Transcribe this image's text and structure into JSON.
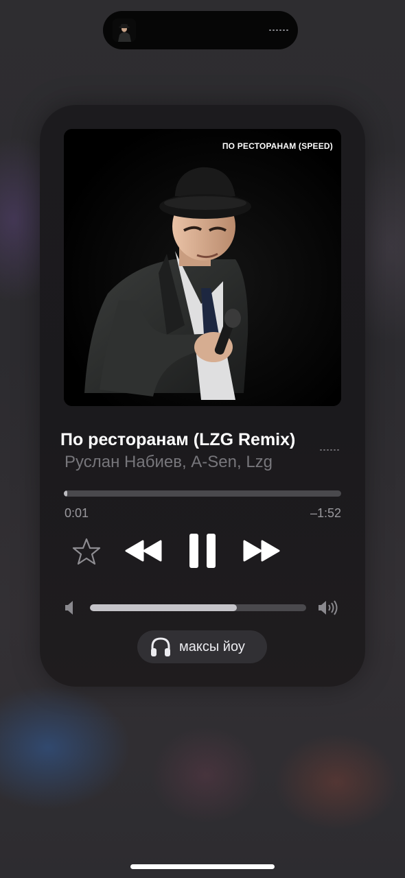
{
  "island": {
    "icon": "album-thumbnail",
    "indicator": "waveform-icon"
  },
  "player": {
    "artwork_caption": "ПО РЕСТОРАНАМ (SPEED)",
    "title": "По ресторанам (LZG Remix)",
    "artist": "Руслан Набиев, A-Sen, Lzg",
    "elapsed": "0:01",
    "remaining": "–1:52",
    "progress": 0.012,
    "volume": 0.68,
    "output_device": "максы йоу",
    "state": "playing"
  },
  "icons": {
    "favorite": "star-icon",
    "previous": "rewind-icon",
    "play_pause": "pause-icon",
    "next": "fast-forward-icon",
    "volume_low": "speaker-low-icon",
    "volume_high": "speaker-high-icon",
    "output": "headphones-icon"
  },
  "colors": {
    "accent": "#ffffff",
    "secondary_text": "#77767b",
    "card": "#1c1b1e"
  }
}
